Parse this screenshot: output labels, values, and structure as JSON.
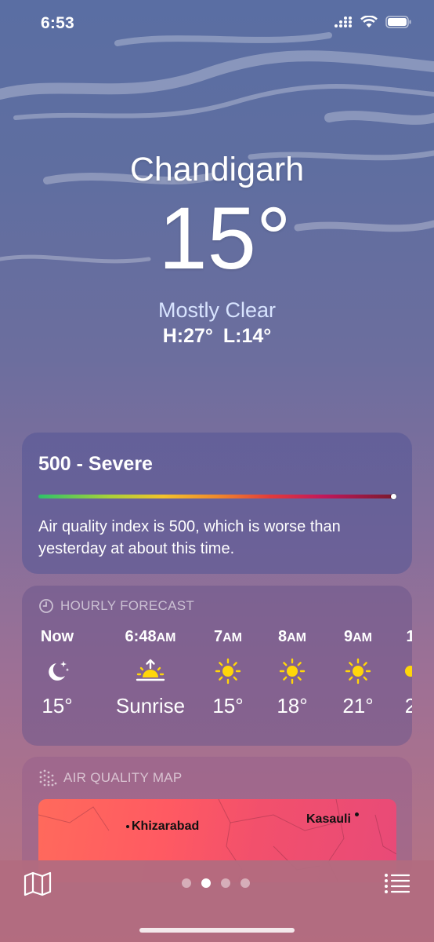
{
  "status_bar": {
    "time": "6:53"
  },
  "weather": {
    "location": "Chandigarh",
    "temperature": "15°",
    "condition": "Mostly Clear",
    "high_low": "H:27°  L:14°"
  },
  "aqi": {
    "value_label": "500 - Severe",
    "description": "Air quality index is 500, which is worse than yesterday at about this time.",
    "level_fraction": 1.0
  },
  "hourly": {
    "header": "HOURLY FORECAST",
    "items": [
      {
        "time": "Now",
        "suffix": "",
        "icon": "moon-stars-icon",
        "temp": "15°"
      },
      {
        "time": "6:48",
        "suffix": "AM",
        "icon": "sunrise-icon",
        "temp": "Sunrise"
      },
      {
        "time": "7",
        "suffix": "AM",
        "icon": "sun-icon",
        "temp": "15°"
      },
      {
        "time": "8",
        "suffix": "AM",
        "icon": "sun-icon",
        "temp": "18°"
      },
      {
        "time": "9",
        "suffix": "AM",
        "icon": "sun-icon",
        "temp": "21°"
      },
      {
        "time": "1",
        "suffix": "",
        "icon": "sun-icon",
        "temp": "2"
      }
    ]
  },
  "air_quality_map": {
    "header": "AIR QUALITY MAP",
    "labels": [
      "Khizarabad",
      "Kasauli"
    ]
  },
  "bottom_bar": {
    "pages": 4,
    "active_page": 2
  },
  "colors": {
    "sun": "#ffd60a",
    "condition_text": "#d8e4ff"
  }
}
